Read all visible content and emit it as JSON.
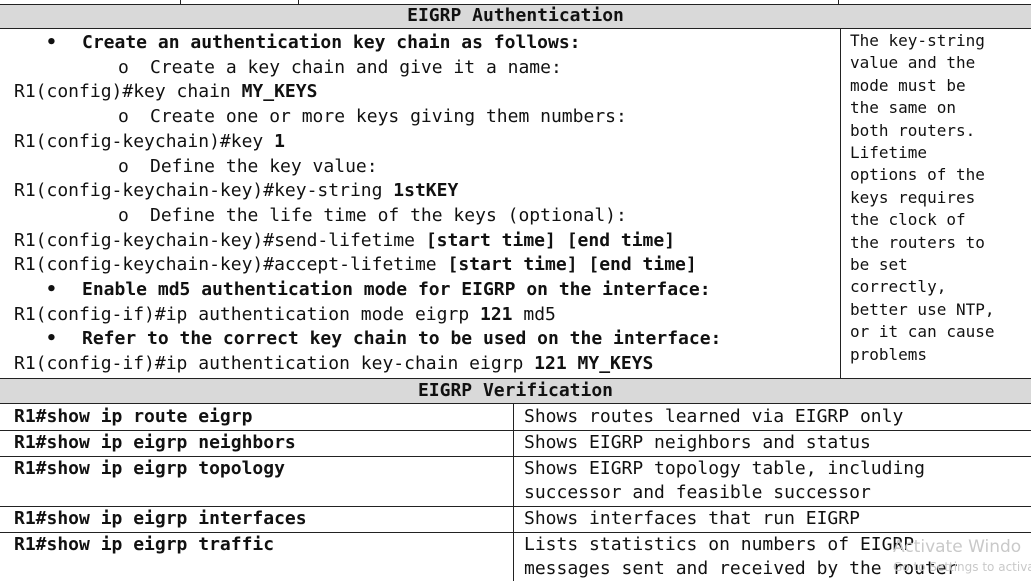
{
  "auth": {
    "title": "EIGRP Authentication",
    "lines": [
      {
        "kind": "bullet",
        "text": "Create an authentication key chain as follows:"
      },
      {
        "kind": "sub",
        "text": "Create a key chain and give it a name:"
      },
      {
        "kind": "cmd",
        "normal": "R1(config)#key chain ",
        "bold": "MY_KEYS",
        "tail": ""
      },
      {
        "kind": "sub",
        "text": "Create one or more keys giving them numbers:"
      },
      {
        "kind": "cmd",
        "normal": "R1(config-keychain)#key ",
        "bold": "1",
        "tail": ""
      },
      {
        "kind": "sub",
        "text": "Define the key value:"
      },
      {
        "kind": "cmd",
        "normal": "R1(config-keychain-key)#key-string ",
        "bold": "1stKEY",
        "tail": ""
      },
      {
        "kind": "sub",
        "text": "Define the life time of the keys (optional):"
      },
      {
        "kind": "cmd",
        "normal": "R1(config-keychain-key)#send-lifetime ",
        "bold": "[start time] [end time]",
        "tail": ""
      },
      {
        "kind": "cmd",
        "normal": "R1(config-keychain-key)#accept-lifetime ",
        "bold": "[start time] [end time]",
        "tail": ""
      },
      {
        "kind": "bullet",
        "text": "Enable md5 authentication mode for EIGRP on the interface:"
      },
      {
        "kind": "cmd",
        "normal": "R1(config-if)#ip authentication mode eigrp ",
        "bold": "121",
        "tail": " md5"
      },
      {
        "kind": "bullet",
        "text": "Refer to the correct key chain to be used on the interface:"
      },
      {
        "kind": "cmd",
        "normal": "R1(config-if)#ip authentication key-chain eigrp ",
        "bold": "121 MY_KEYS",
        "tail": ""
      }
    ],
    "note": "The key-string\nvalue and the\nmode must be\nthe same on\nboth routers.\nLifetime\noptions of the\nkeys requires\nthe clock of\nthe routers to\nbe set\ncorrectly,\nbetter use NTP,\nor it can cause\nproblems"
  },
  "verify": {
    "title": "EIGRP Verification",
    "rows": [
      {
        "command": "R1#show ip route eigrp",
        "desc": "Shows routes learned via EIGRP only"
      },
      {
        "command": "R1#show ip eigrp neighbors",
        "desc": "Shows EIGRP neighbors and status"
      },
      {
        "command": "R1#show ip eigrp topology",
        "desc": "Shows EIGRP topology table, including\nsuccessor and feasible successor"
      },
      {
        "command": "R1#show ip eigrp interfaces",
        "desc": "Shows interfaces that run EIGRP"
      },
      {
        "command": "R1#show ip eigrp traffic",
        "desc": "Lists statistics on numbers of EIGRP\nmessages sent and received by the router"
      }
    ]
  },
  "watermark": {
    "line1": "Activate Windo",
    "line2": "Go to Settings to activate"
  }
}
